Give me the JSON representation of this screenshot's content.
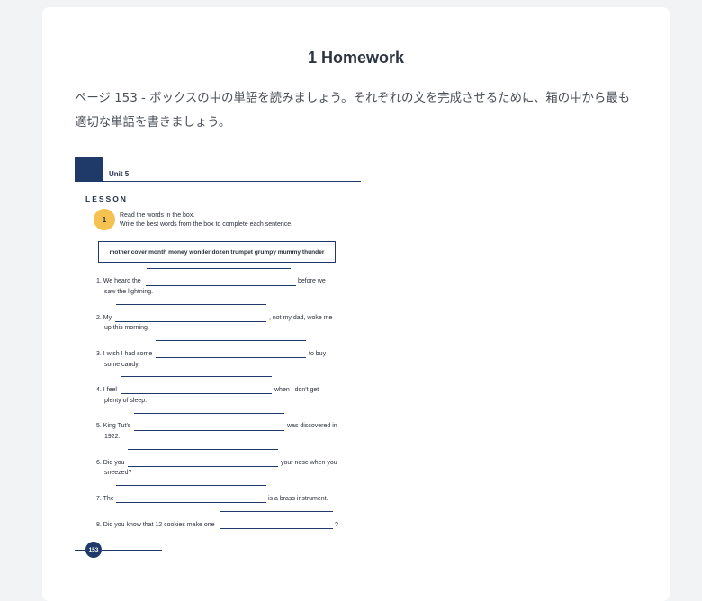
{
  "header": {
    "title": "1 Homework"
  },
  "instruction": "ページ 153 - ボックスの中の単語を読みましょう。それぞれの文を完成させるために、箱の中から最も適切な単語を書きましょう。",
  "worksheet": {
    "unit": "Unit 5",
    "lesson": "LESSON",
    "exercise_number": "1",
    "directions": [
      "Read the words in the box.",
      "Write  the best words from the box to complete each sentence."
    ],
    "word_box": "mother  cover  month  money  wonder  dozen  trumpet  grumpy  mummy  thunder",
    "sentences": [
      {
        "a": "1. We  heard the",
        "b": "before we",
        "c": "saw the lightning."
      },
      {
        "a": "2. My",
        "b": ", not my dad, woke me",
        "c": "up this morning."
      },
      {
        "a": "3. I wish I had some",
        "b": "to buy",
        "c": "some candy."
      },
      {
        "a": "4. I feel",
        "b": "when I don't get",
        "c": "plenty of sleep."
      },
      {
        "a": "5. King Tut's",
        "b": "was discovered in",
        "c": "1922."
      },
      {
        "a": "6. Did you",
        "b": "your nose when you",
        "c": "sneezed?"
      },
      {
        "a": "7. The",
        "b": "is a brass instrument.",
        "c": ""
      },
      {
        "a": "8. Did you know that 12 cookies make one",
        "b": "?",
        "c": ""
      }
    ],
    "page_number": "153"
  },
  "colors": {
    "accent": "#1f3a68",
    "badge": "#f5c150",
    "background": "#f2f3f5"
  }
}
